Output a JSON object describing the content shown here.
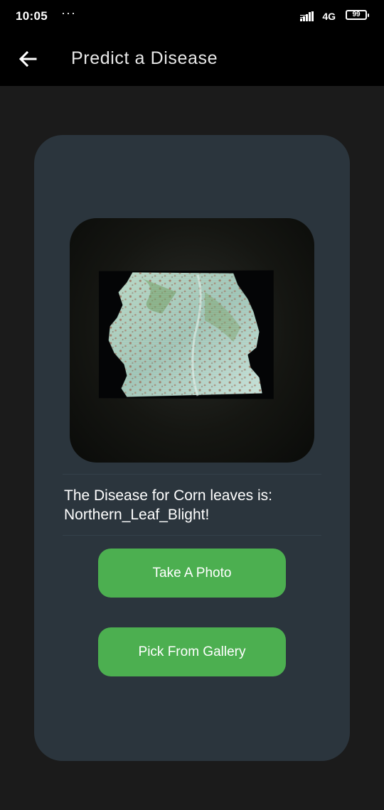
{
  "status_bar": {
    "time": "10:05",
    "notification_dots": "···",
    "network": "4G",
    "battery": "99"
  },
  "app_bar": {
    "back_icon": "arrow-left-icon",
    "title": "Predict a Disease"
  },
  "card": {
    "image": "corn-leaf-photo",
    "result": {
      "line1": "The Disease for Corn leaves is:",
      "line2": "Northern_Leaf_Blight!"
    },
    "take_photo_label": "Take A Photo",
    "pick_gallery_label": "Pick From Gallery"
  },
  "colors": {
    "background": "#1b1b1b",
    "app_bar": "#000000",
    "card": "#2b353d",
    "button": "#4caf50",
    "text": "#ffffff"
  }
}
